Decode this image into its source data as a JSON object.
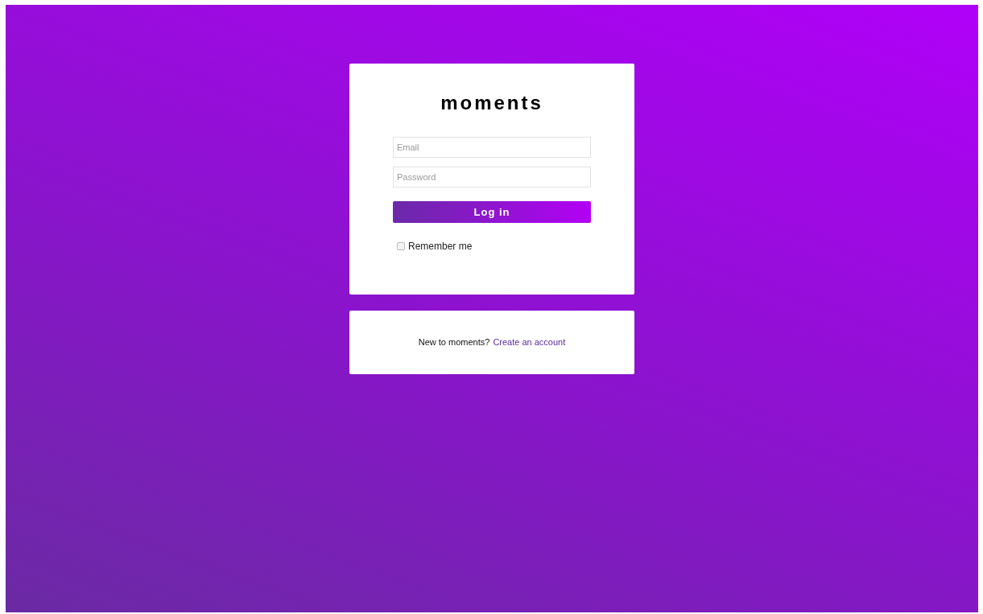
{
  "logo": "moments",
  "login_form": {
    "email": {
      "placeholder": "Email"
    },
    "password": {
      "placeholder": "Password"
    },
    "submit": "Log in",
    "remember_me": {
      "label": "Remember me",
      "checked": false
    }
  },
  "signup_prompt": {
    "text": "New to moments?",
    "link": "Create an account"
  }
}
